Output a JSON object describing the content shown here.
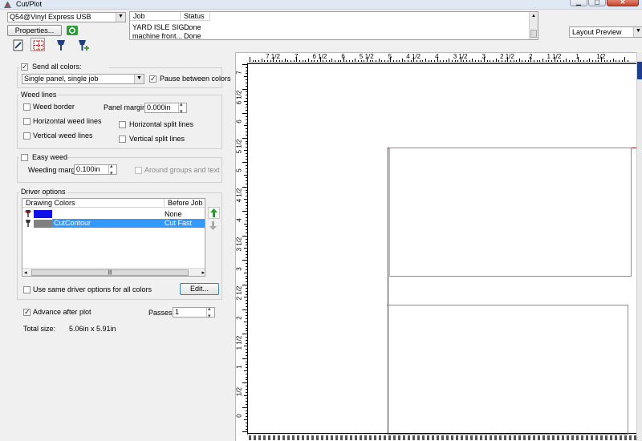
{
  "window": {
    "title": "Cut/Plot",
    "buttons": [
      {
        "name": "minimize",
        "glyph": "▁"
      },
      {
        "name": "maximize",
        "glyph": "▢"
      },
      {
        "name": "close",
        "glyph": "✕"
      }
    ]
  },
  "device": {
    "selected": "Q54@Vinyl Express USB",
    "properties_label": "Properties..."
  },
  "jobs": {
    "columns": [
      "Job",
      "Status"
    ],
    "rows": [
      {
        "job": "YARD ISLE SIG...",
        "status": "Done"
      },
      {
        "job": "machine front...",
        "status": "Done"
      }
    ]
  },
  "view_mode": {
    "selected": "Layout Preview"
  },
  "colors": {
    "send_all_label": "Send all colors:",
    "send_all_checked": true,
    "mode": "Single panel, single job",
    "pause_label": "Pause between colors",
    "pause_checked": true
  },
  "weed_lines": {
    "legend": "Weed lines",
    "weed_border": "Weed border",
    "panel_margin_label": "Panel margin:",
    "panel_margin_value": "0.000in",
    "horizontal_weed": "Horizontal weed lines",
    "horizontal_split": "Horizontal split lines",
    "vertical_weed": "Vertical weed lines",
    "vertical_split": "Vertical split lines"
  },
  "easy_weed": {
    "label": "Easy weed",
    "margin_label": "Weeding margin:",
    "margin_value": "0.100in",
    "around_label": "Around groups and text"
  },
  "driver": {
    "legend": "Driver options",
    "columns": [
      "Drawing Colors",
      "Before Job"
    ],
    "rows": [
      {
        "name": "",
        "value": "None",
        "color": "#1010e8",
        "selected": false
      },
      {
        "name": "CutContour",
        "value": "Cut Fast",
        "color": "#808080",
        "selected": true
      }
    ],
    "same_options_label": "Use same driver options for all colors",
    "edit_label": "Edit..."
  },
  "advance": {
    "label": "Advance after plot",
    "checked": true
  },
  "passes": {
    "label": "Passes:",
    "value": "1"
  },
  "total_size": {
    "label": "Total size:",
    "value": "5.06in x  5.91in"
  },
  "ruler": {
    "top_labels": [
      "7 1/2",
      "7",
      "6 1/2",
      "6",
      "5 1/2",
      "5",
      "4 1/2",
      "4",
      "3 1/2",
      "3",
      "2 1/2",
      "2",
      "1 1/2",
      "1",
      "1/2"
    ],
    "left_labels": [
      "7",
      "6 1/2",
      "6",
      "5 1/2",
      "5",
      "4 1/2",
      "4",
      "3 1/2",
      "3",
      "2 1/2",
      "2",
      "1 1/2",
      "1",
      "1/2",
      "0"
    ]
  },
  "accent": {
    "selection": "#3399ff",
    "cut_line": "#8b1a1a"
  }
}
